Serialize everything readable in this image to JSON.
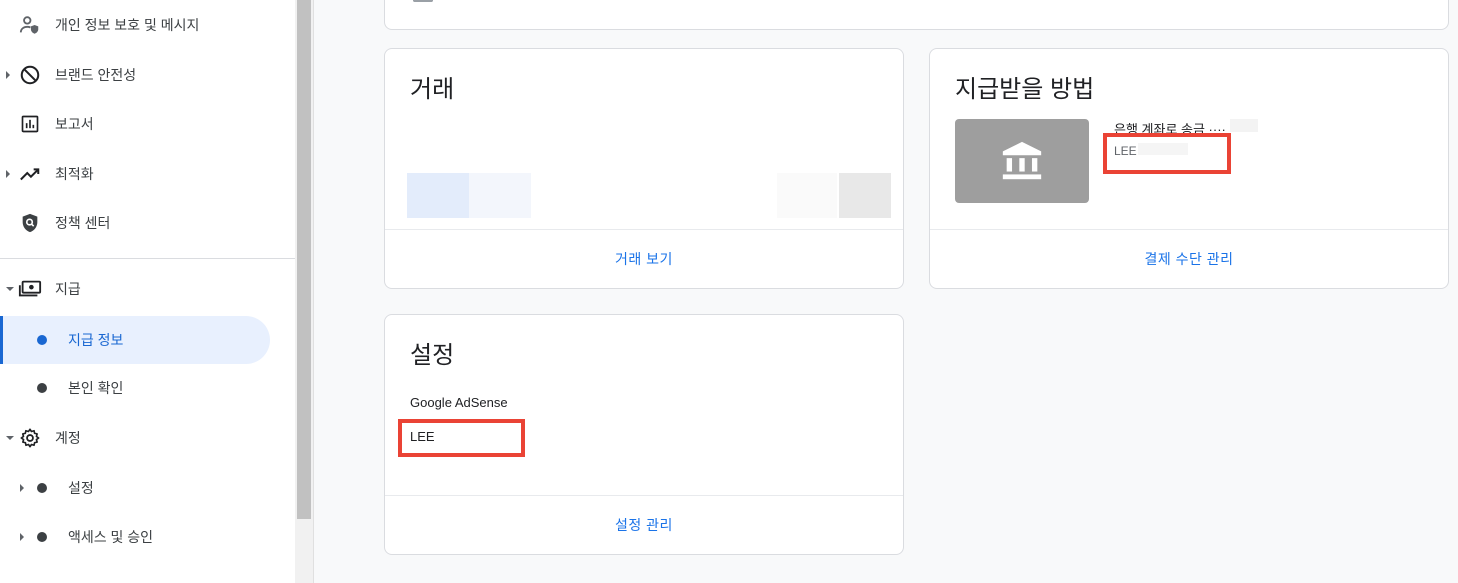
{
  "sidebar": {
    "items": [
      {
        "label": "개인 정보 보호 및 메시지",
        "icon": "person-shield-icon"
      },
      {
        "label": "브랜드 안전성",
        "icon": "block-icon"
      },
      {
        "label": "보고서",
        "icon": "bar-chart-icon"
      },
      {
        "label": "최적화",
        "icon": "trending-up-icon"
      },
      {
        "label": "정책 센터",
        "icon": "policy-shield-icon"
      },
      {
        "label": "지급",
        "icon": "payments-icon"
      },
      {
        "label": "지급 정보"
      },
      {
        "label": "본인 확인"
      },
      {
        "label": "계정",
        "icon": "gear-icon"
      },
      {
        "label": "설정"
      },
      {
        "label": "액세스 및 승인"
      }
    ]
  },
  "cards": {
    "transactions": {
      "title": "거래",
      "link": "거래 보기"
    },
    "payout_method": {
      "title": "지급받을 방법",
      "method": "은행 계좌로 송금 ····",
      "holder": "LEE",
      "link": "결제 수단 관리"
    },
    "settings": {
      "title": "설정",
      "product": "Google AdSense",
      "holder": "LEE",
      "link": "설정 관리"
    }
  },
  "colors": {
    "accent": "#1a73e8",
    "active_bg": "#e8f0fe",
    "highlight_box": "#ea4335",
    "bank_tile": "#9e9e9e"
  }
}
